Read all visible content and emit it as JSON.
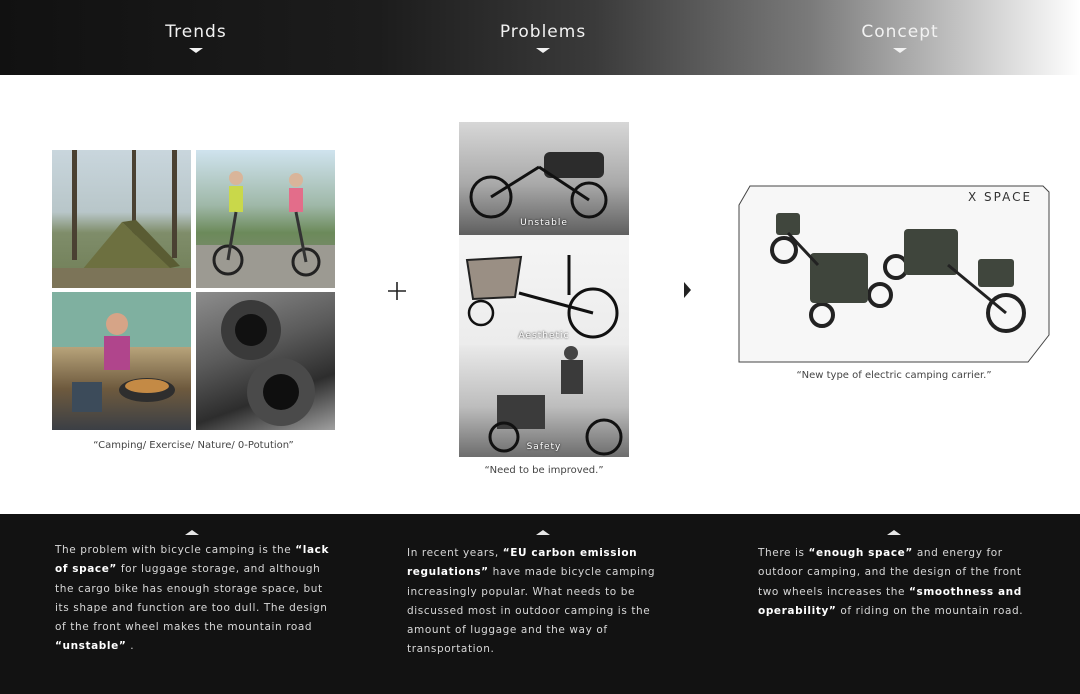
{
  "header": {
    "tabs": [
      {
        "label": "Trends"
      },
      {
        "label": "Problems"
      },
      {
        "label": "Concept"
      }
    ]
  },
  "trends": {
    "caption": "“Camping/ Exercise/ Nature/ 0-Potution”"
  },
  "problems": {
    "labels": [
      "Unstable",
      "Aesthetic",
      "Safety"
    ],
    "caption": "“Need to be improved.”"
  },
  "concept": {
    "logo": "X SPACE",
    "caption": "“New type of electric camping carrier.”"
  },
  "footer": {
    "col1": {
      "p1": "The problem with bicycle camping is the ",
      "b1": "“lack of space”",
      "p2": " for luggage storage, and although the cargo bike has enough storage space, but its shape and function are too dull. The design of the front wheel makes the mountain road ",
      "b2": "“unstable”",
      "p3": " ."
    },
    "col2": {
      "p1": "In recent years, ",
      "b1": "“EU carbon emission regulations”",
      "p2": " have made bicycle camping increasingly popular. What needs to be discussed most in outdoor camping is the amount of luggage and the way of transportation."
    },
    "col3": {
      "p1": "There is ",
      "b1": "“enough space”",
      "p2": " and energy for outdoor camping, and the design of the front two wheels increases the ",
      "b2": "“smoothness and operability”",
      "p3": " of riding on the mountain road."
    }
  }
}
